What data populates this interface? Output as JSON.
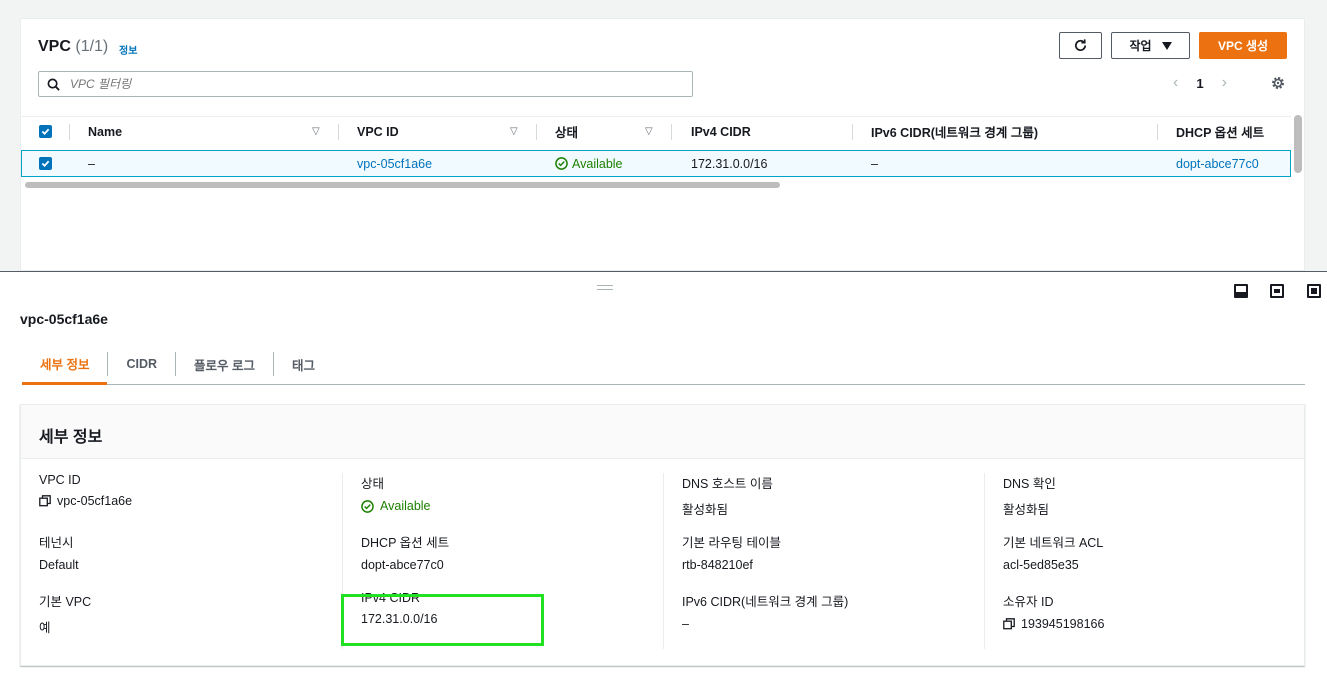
{
  "list": {
    "title": "VPC",
    "count": "(1/1)",
    "info": "정보",
    "actions_label": "작업",
    "create_label": "VPC 생성",
    "search_placeholder": "VPC 필터링",
    "page": "1",
    "columns": [
      "Name",
      "VPC ID",
      "상태",
      "IPv4 CIDR",
      "IPv6 CIDR(네트워크 경계 그룹)",
      "DHCP 옵션 세트"
    ],
    "row": {
      "name": "–",
      "vpc_id": "vpc-05cf1a6e",
      "status": "Available",
      "ipv4": "172.31.0.0/16",
      "ipv6": "–",
      "dhcp": "dopt-abce77c0"
    }
  },
  "detail": {
    "vpc_id": "vpc-05cf1a6e",
    "tabs": [
      "세부 정보",
      "CIDR",
      "플로우 로그",
      "태그"
    ],
    "card_title": "세부 정보",
    "col1": [
      {
        "label": "VPC ID",
        "value": "vpc-05cf1a6e"
      },
      {
        "label": "테넌시",
        "value": "Default"
      },
      {
        "label": "기본 VPC",
        "value": "예"
      }
    ],
    "col2": [
      {
        "label": "상태",
        "value": "Available"
      },
      {
        "label": "DHCP 옵션 세트",
        "value": "dopt-abce77c0"
      },
      {
        "label": "IPv4 CIDR",
        "value": "172.31.0.0/16"
      }
    ],
    "col3": [
      {
        "label": "DNS 호스트 이름",
        "value": "활성화됨"
      },
      {
        "label": "기본 라우팅 테이블",
        "value": "rtb-848210ef"
      },
      {
        "label": "IPv6 CIDR(네트워크 경계 그룹)",
        "value": "–"
      }
    ],
    "col4": [
      {
        "label": "DNS 확인",
        "value": "활성화됨"
      },
      {
        "label": "기본 네트워크 ACL",
        "value": "acl-5ed85e35"
      },
      {
        "label": "소유자 ID",
        "value": "193945198166"
      }
    ]
  },
  "colors": {
    "accent": "#ec7211",
    "link": "#0073bb",
    "success": "#1d8102",
    "highlight": "#22e122"
  }
}
